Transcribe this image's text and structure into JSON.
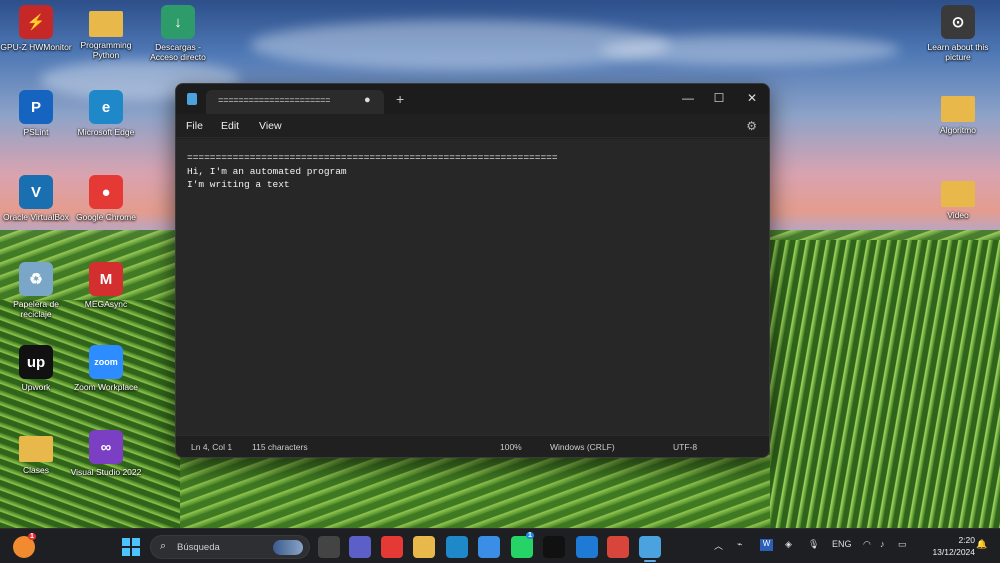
{
  "desktop_icons": [
    {
      "label": "GPU-Z HWMonitor",
      "icon": "gpu-monitor-icon",
      "color": "#c62828",
      "glyph": "⚡"
    },
    {
      "label": "Programming Python",
      "icon": "folder-icon",
      "color": "#e8b84a",
      "glyph": ""
    },
    {
      "label": "Descargas - Acceso directo",
      "icon": "download-folder-icon",
      "color": "#2e9b6b",
      "glyph": "↓"
    },
    {
      "label": "PSLint",
      "icon": "pslint-icon",
      "color": "#1565c0",
      "glyph": "P"
    },
    {
      "label": "Microsoft Edge",
      "icon": "edge-icon",
      "color": "#1e88c8",
      "glyph": "e"
    },
    {
      "label": "Oracle VirtualBox",
      "icon": "virtualbox-icon",
      "color": "#1a6fb0",
      "glyph": "V"
    },
    {
      "label": "Google Chrome",
      "icon": "chrome-icon",
      "color": "#e53935",
      "glyph": "●"
    },
    {
      "label": "Papelera de reciclaje",
      "icon": "recycle-bin-icon",
      "color": "#7aa7c7",
      "glyph": "♻"
    },
    {
      "label": "MEGAsync",
      "icon": "mega-icon",
      "color": "#d32f2f",
      "glyph": "M"
    },
    {
      "label": "Upwork",
      "icon": "upwork-icon",
      "color": "#111111",
      "glyph": "up"
    },
    {
      "label": "Zoom Workplace",
      "icon": "zoom-icon",
      "color": "#2d8cff",
      "glyph": "zoom"
    },
    {
      "label": "Clases",
      "icon": "folder-icon",
      "color": "#e8b84a",
      "glyph": ""
    },
    {
      "label": "Visual Studio 2022",
      "icon": "visual-studio-icon",
      "color": "#7b3fc4",
      "glyph": "∞"
    },
    {
      "label": "Learn about this picture",
      "icon": "learn-picture-icon",
      "color": "#3a3a3a",
      "glyph": "⊙"
    },
    {
      "label": "Algoritmo",
      "icon": "folder-icon",
      "color": "#e8b84a",
      "glyph": ""
    },
    {
      "label": "Video",
      "icon": "folder-icon",
      "color": "#e8b84a",
      "glyph": ""
    }
  ],
  "notepad": {
    "tab_title": "======================",
    "modified_dot": "●",
    "new_tab": "+",
    "controls": {
      "minimize": "—",
      "maximize": "☐",
      "close": "✕"
    },
    "menu": {
      "file": "File",
      "edit": "Edit",
      "view": "View"
    },
    "settings_glyph": "⚙",
    "content_lines": [
      "=================================================================",
      "Hi, I'm an automated program",
      "I'm writing a text"
    ],
    "status": {
      "position": "Ln 4, Col 1",
      "characters": "115 characters",
      "zoom": "100%",
      "line_ending": "Windows (CRLF)",
      "encoding": "UTF-8"
    }
  },
  "taskbar": {
    "search_placeholder": "Búsqueda",
    "apps": [
      {
        "name": "task-view",
        "color": "#444"
      },
      {
        "name": "teams",
        "color": "#5b5fc7"
      },
      {
        "name": "chrome",
        "color": "#e53935"
      },
      {
        "name": "file-explorer",
        "color": "#e8b84a"
      },
      {
        "name": "edge",
        "color": "#1e88c8"
      },
      {
        "name": "store",
        "color": "#3a8ee6"
      },
      {
        "name": "whatsapp",
        "color": "#25d366"
      },
      {
        "name": "upwork",
        "color": "#111"
      },
      {
        "name": "vscode",
        "color": "#1f7ad6"
      },
      {
        "name": "snipping-tool",
        "color": "#d8453b"
      },
      {
        "name": "notepad",
        "color": "#4aa3df"
      }
    ],
    "whatsapp_badge": "1",
    "weather_badge": "1",
    "tray": {
      "language": "ENG"
    },
    "clock": {
      "time": "2:20",
      "date": "13/12/2024"
    }
  }
}
